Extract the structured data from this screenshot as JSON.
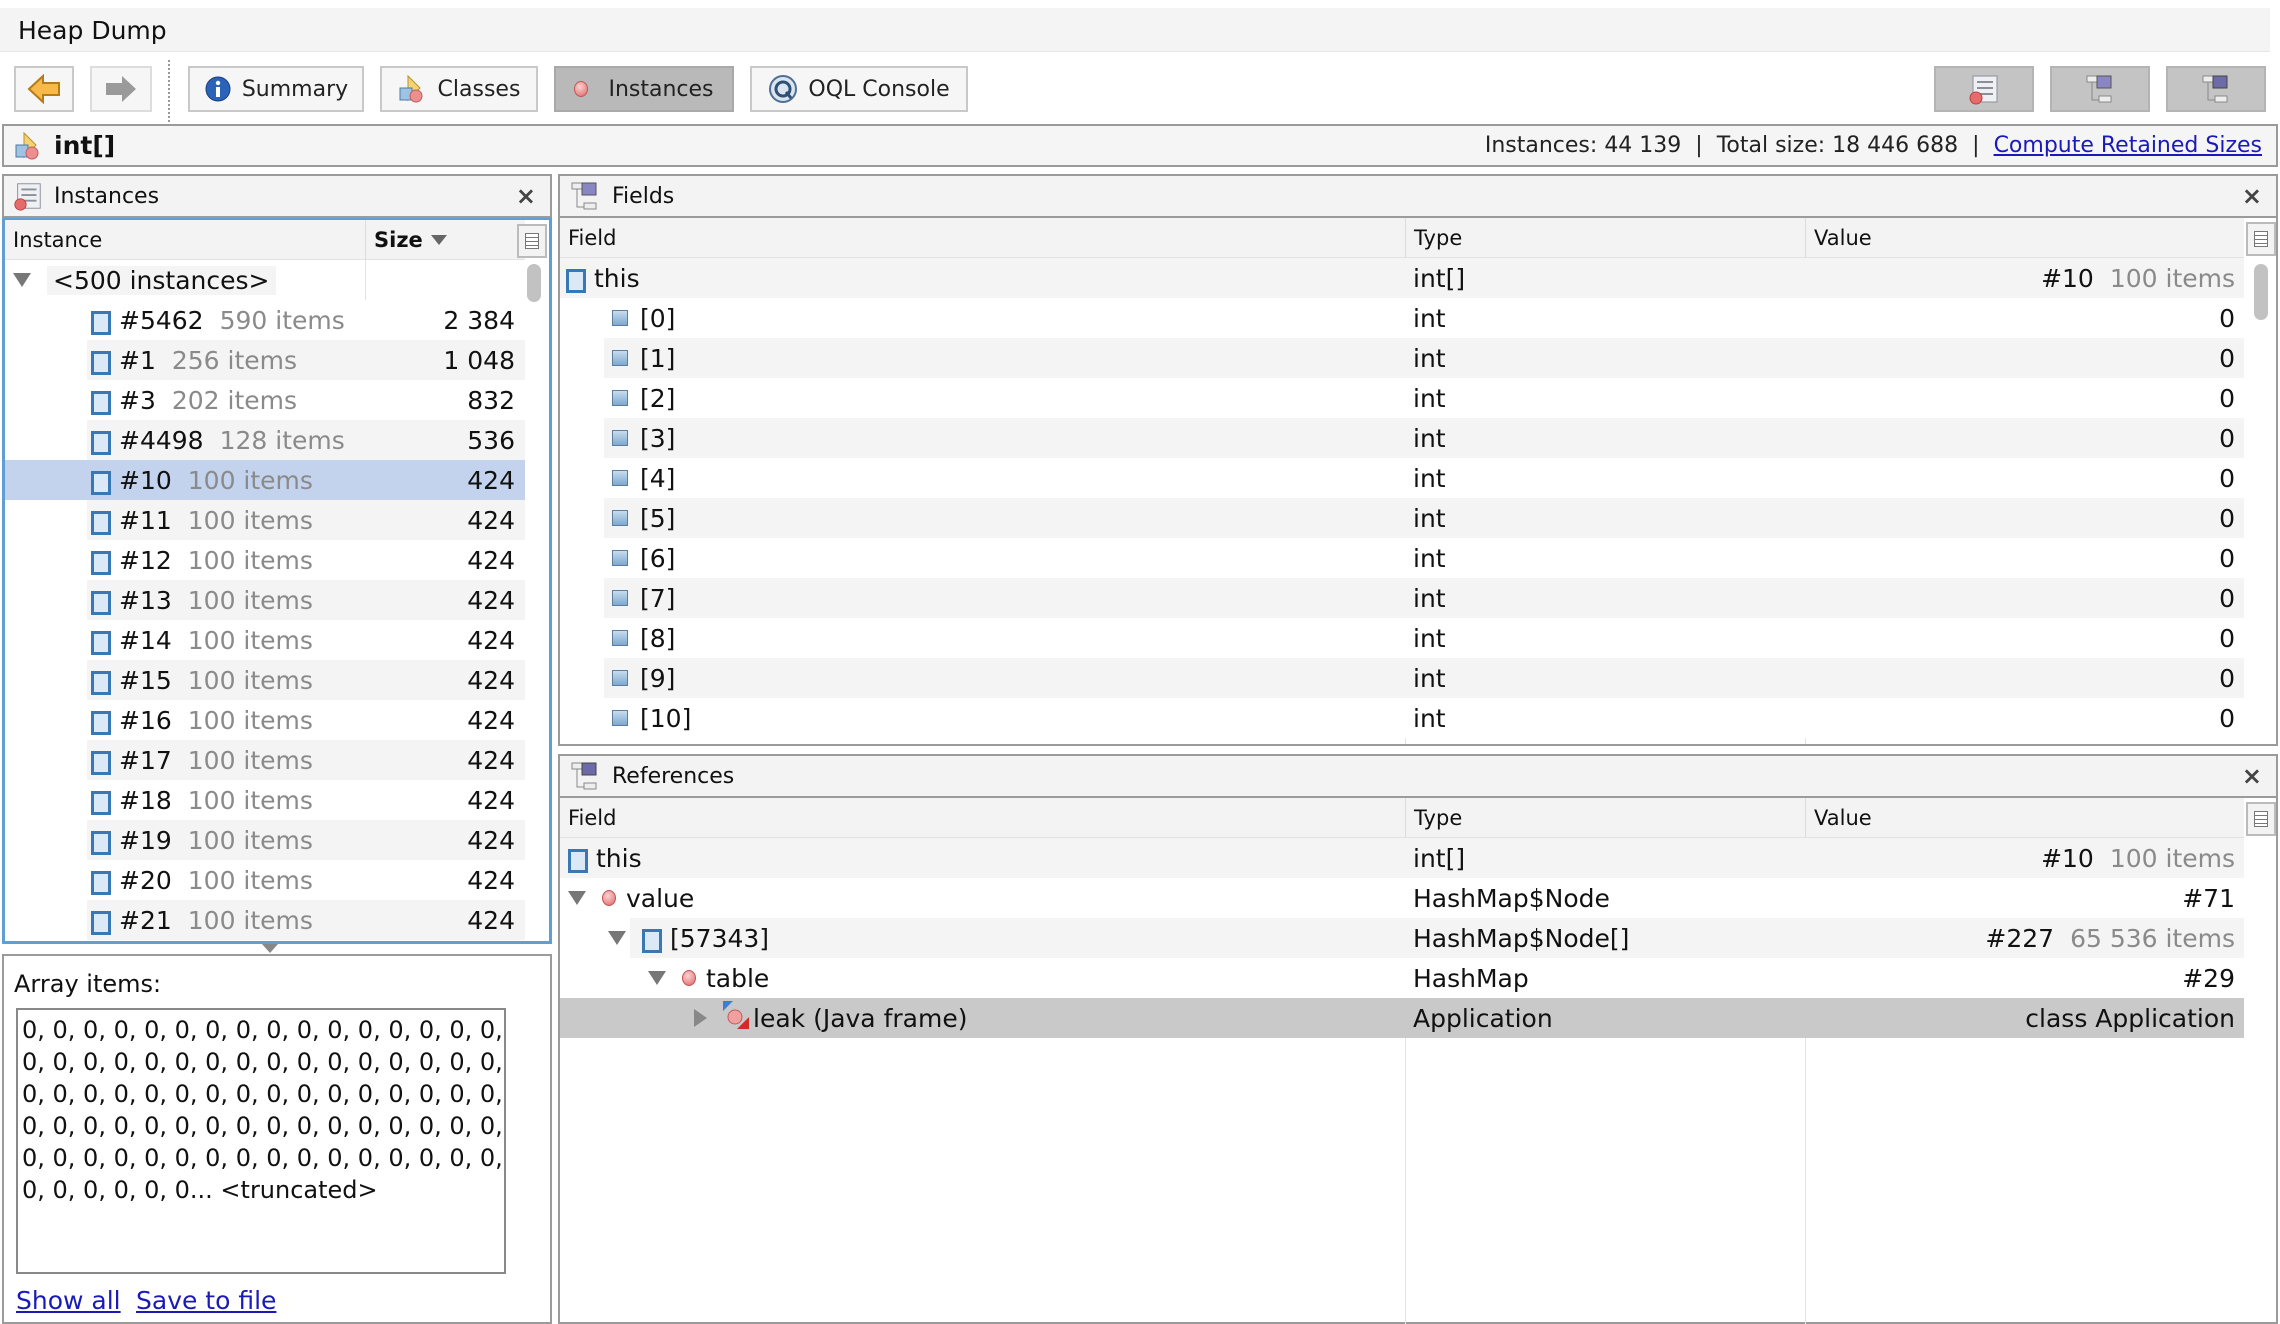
{
  "window": {
    "title": "Heap Dump"
  },
  "toolbar": {
    "back_icon": "back-arrow-icon",
    "forward_icon": "forward-arrow-icon",
    "tabs": [
      {
        "label": "Summary",
        "icon": "info-icon"
      },
      {
        "label": "Classes",
        "icon": "classes-icon"
      },
      {
        "label": "Instances",
        "icon": "instance-icon",
        "active": true
      },
      {
        "label": "OQL Console",
        "icon": "oql-icon"
      }
    ],
    "right_buttons": [
      {
        "name": "instances-view",
        "icon": "instances-list-icon"
      },
      {
        "name": "fields-view",
        "icon": "fields-tree-icon"
      },
      {
        "name": "references-view",
        "icon": "references-tree-icon"
      }
    ]
  },
  "classbar": {
    "class_name": "int[]",
    "instances_label": "Instances:",
    "instances_value": "44 139",
    "separator": "|",
    "total_size_label": "Total size:",
    "total_size_value": "18 446 688",
    "compute_link": "Compute Retained Sizes"
  },
  "instances_panel": {
    "title": "Instances",
    "close": "×",
    "columns": [
      "Instance",
      "Size"
    ],
    "sort_indicator": "descending",
    "group_label": "<500 instances>",
    "rows": [
      {
        "id": "#5462",
        "items": "590 items",
        "size": "2 384"
      },
      {
        "id": "#1",
        "items": "256 items",
        "size": "1 048"
      },
      {
        "id": "#3",
        "items": "202 items",
        "size": "832"
      },
      {
        "id": "#4498",
        "items": "128 items",
        "size": "536"
      },
      {
        "id": "#10",
        "items": "100 items",
        "size": "424",
        "selected": true
      },
      {
        "id": "#11",
        "items": "100 items",
        "size": "424"
      },
      {
        "id": "#12",
        "items": "100 items",
        "size": "424"
      },
      {
        "id": "#13",
        "items": "100 items",
        "size": "424"
      },
      {
        "id": "#14",
        "items": "100 items",
        "size": "424"
      },
      {
        "id": "#15",
        "items": "100 items",
        "size": "424"
      },
      {
        "id": "#16",
        "items": "100 items",
        "size": "424"
      },
      {
        "id": "#17",
        "items": "100 items",
        "size": "424"
      },
      {
        "id": "#18",
        "items": "100 items",
        "size": "424"
      },
      {
        "id": "#19",
        "items": "100 items",
        "size": "424"
      },
      {
        "id": "#20",
        "items": "100 items",
        "size": "424"
      },
      {
        "id": "#21",
        "items": "100 items",
        "size": "424"
      }
    ]
  },
  "array_items": {
    "label": "Array items:",
    "lines": [
      "0, 0, 0, 0, 0, 0, 0, 0, 0, 0, 0, 0, 0, 0, 0, 0,",
      "0, 0, 0, 0, 0, 0, 0, 0, 0, 0, 0, 0, 0, 0, 0, 0,",
      "0, 0, 0, 0, 0, 0, 0, 0, 0, 0, 0, 0, 0, 0, 0, 0,",
      "0, 0, 0, 0, 0, 0, 0, 0, 0, 0, 0, 0, 0, 0, 0, 0,",
      "0, 0, 0, 0, 0, 0, 0, 0, 0, 0, 0, 0, 0, 0, 0, 0,",
      "0, 0, 0, 0, 0, 0... <truncated>"
    ],
    "show_all": "Show all",
    "save_to_file": "Save to file"
  },
  "fields_panel": {
    "title": "Fields",
    "close": "×",
    "columns": [
      "Field",
      "Type",
      "Value"
    ],
    "this_row": {
      "field": "this",
      "type": "int[]",
      "value_id": "#10",
      "value_items": "100 items"
    },
    "rows": [
      {
        "field": "[0]",
        "type": "int",
        "value": "0"
      },
      {
        "field": "[1]",
        "type": "int",
        "value": "0"
      },
      {
        "field": "[2]",
        "type": "int",
        "value": "0"
      },
      {
        "field": "[3]",
        "type": "int",
        "value": "0"
      },
      {
        "field": "[4]",
        "type": "int",
        "value": "0"
      },
      {
        "field": "[5]",
        "type": "int",
        "value": "0"
      },
      {
        "field": "[6]",
        "type": "int",
        "value": "0"
      },
      {
        "field": "[7]",
        "type": "int",
        "value": "0"
      },
      {
        "field": "[8]",
        "type": "int",
        "value": "0"
      },
      {
        "field": "[9]",
        "type": "int",
        "value": "0"
      },
      {
        "field": "[10]",
        "type": "int",
        "value": "0"
      }
    ]
  },
  "references_panel": {
    "title": "References",
    "close": "×",
    "columns": [
      "Field",
      "Type",
      "Value"
    ],
    "rows": [
      {
        "field": "this",
        "icon": "array-icon",
        "type": "int[]",
        "value_id": "#10",
        "value_items": "100 items",
        "expander": "none",
        "depth": 0
      },
      {
        "field": "value",
        "icon": "object-icon",
        "type": "HashMap$Node",
        "value_id": "#71",
        "value_items": "",
        "expander": "expanded",
        "depth": 0
      },
      {
        "field": "[57343]",
        "icon": "array-icon",
        "type": "HashMap$Node[]",
        "value_id": "#227",
        "value_items": "65 536 items",
        "expander": "expanded",
        "depth": 1
      },
      {
        "field": "table",
        "icon": "object-icon",
        "type": "HashMap",
        "value_id": "#29",
        "value_items": "",
        "expander": "expanded",
        "depth": 2
      },
      {
        "field": "leak (Java frame)",
        "icon": "gc-root-icon",
        "type": "Application",
        "value_id": "class Application",
        "value_items": "",
        "expander": "collapsed",
        "depth": 3,
        "selected": true
      }
    ]
  },
  "colors": {
    "selection": "#c3d3ed",
    "row_selected_gray": "#c9c9c9",
    "link": "#1a1ab8",
    "panel_border_focus": "#5f9fd6"
  }
}
